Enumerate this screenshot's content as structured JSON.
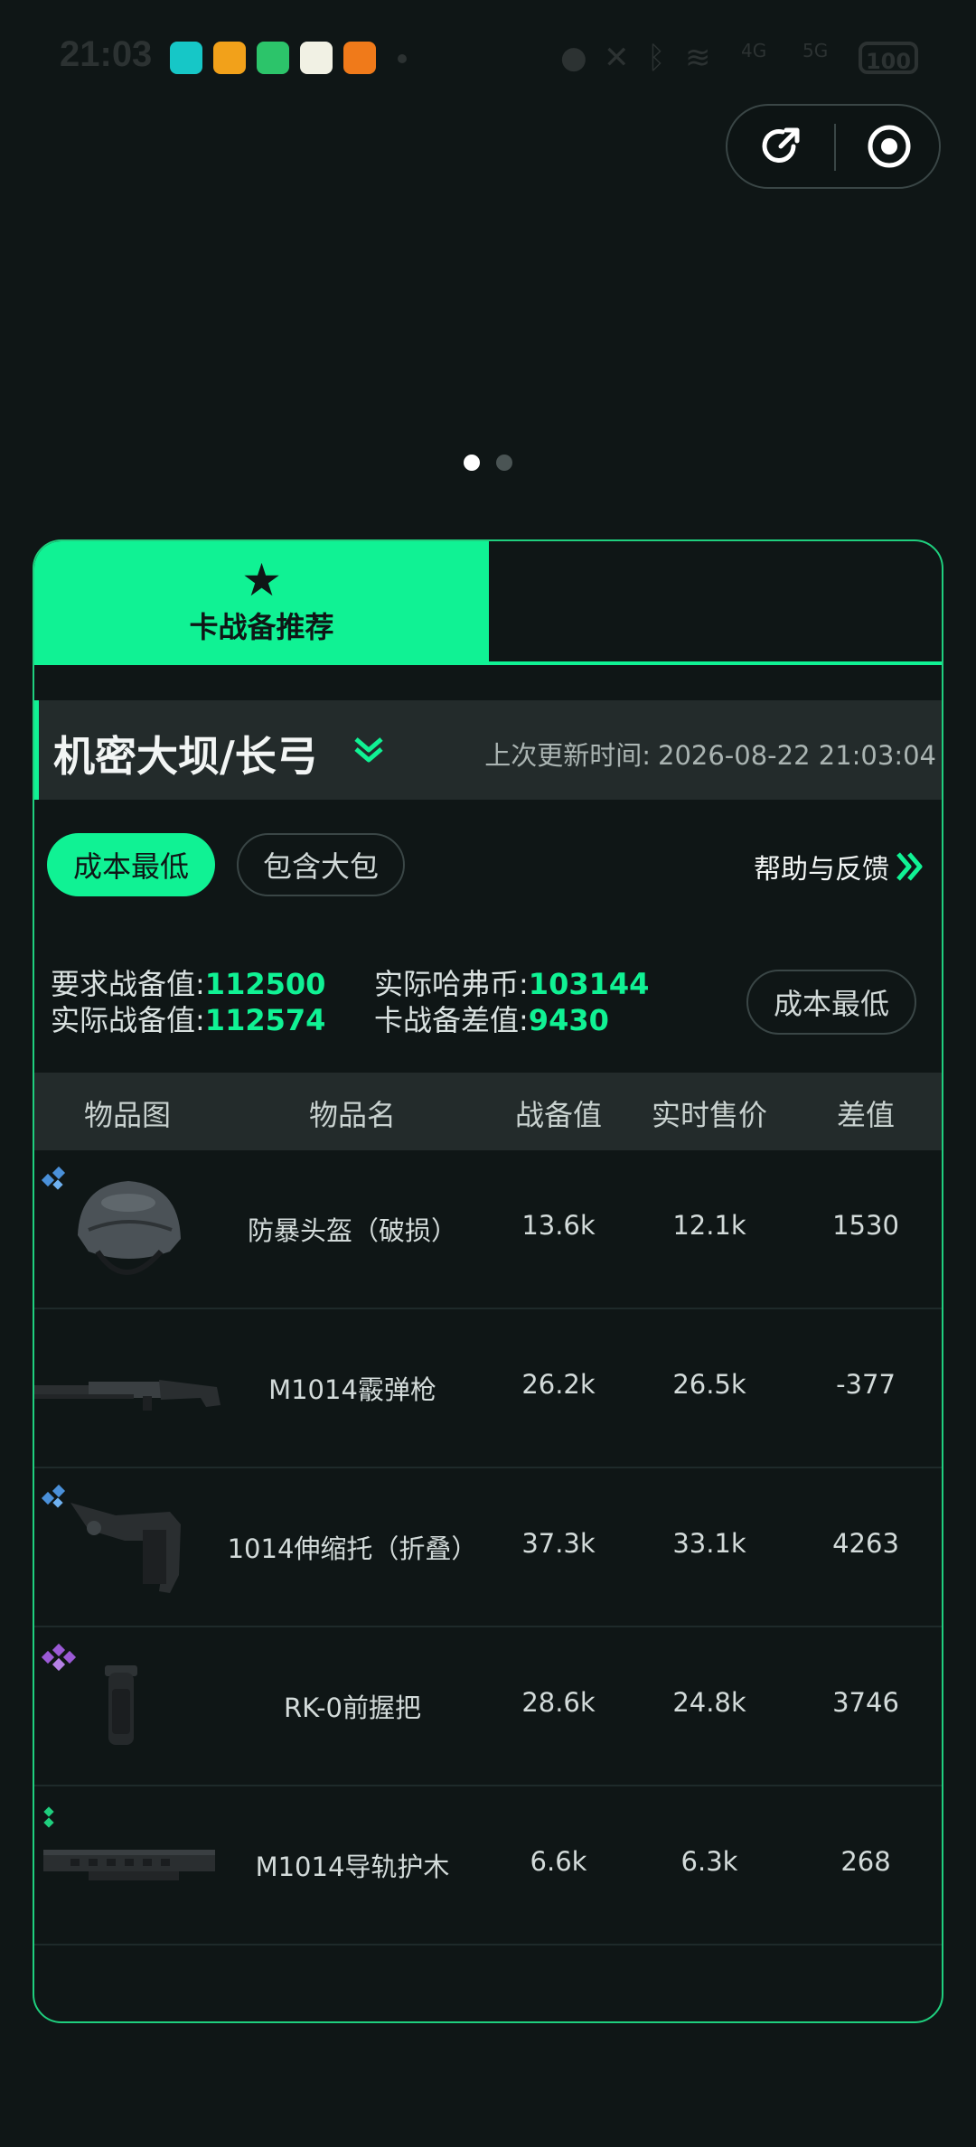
{
  "status_bar": {
    "time": "21:03",
    "app_icons": [
      "tap-icon",
      "app-icon-yellow",
      "battery-saver-icon",
      "video-app-icon",
      "orange-app-icon"
    ],
    "battery": "100",
    "network": [
      "4G",
      "5G"
    ]
  },
  "capsule": {
    "share_icon": "share-icon",
    "close_icon": "record-icon"
  },
  "pager": {
    "count": 2,
    "active_index": 0
  },
  "tabs": [
    {
      "label": "卡战备推荐",
      "icon": "star-icon",
      "active": true
    },
    {
      "label": "",
      "active": false
    }
  ],
  "map": {
    "name": "机密大坝/长弓",
    "update_label": "上次更新时间:",
    "update_time": "2026-08-22 21:03:04"
  },
  "filters": [
    {
      "label": "成本最低",
      "active": true
    },
    {
      "label": "包含大包",
      "active": false
    }
  ],
  "help_label": "帮助与反馈",
  "stats": {
    "required_label": "要求战备值:",
    "required_value": "112500",
    "actual_label": "实际战备值:",
    "actual_value": "112574",
    "coins_label": "实际哈弗币:",
    "coins_value": "103144",
    "diff_label": "卡战备差值:",
    "diff_value": "9430",
    "sort_button": "成本最低"
  },
  "table": {
    "headers": [
      "物品图",
      "物品名",
      "战备值",
      "实时售价",
      "差值"
    ],
    "rows": [
      {
        "image": "helmet-image",
        "rarity": "blue",
        "name": "防暴头盔（破损）",
        "value": "13.6k",
        "price": "12.1k",
        "diff": "1530"
      },
      {
        "image": "shotgun-image",
        "rarity": "none",
        "name": "M1014霰弹枪",
        "value": "26.2k",
        "price": "26.5k",
        "diff": "-377"
      },
      {
        "image": "stock-image",
        "rarity": "blue",
        "name": "1014伸缩托（折叠）",
        "value": "37.3k",
        "price": "33.1k",
        "diff": "4263"
      },
      {
        "image": "grip-image",
        "rarity": "purple",
        "name": "RK-0前握把",
        "value": "28.6k",
        "price": "24.8k",
        "diff": "3746"
      },
      {
        "image": "handguard-image",
        "rarity": "green",
        "name": "M1014导轨护木",
        "value": "6.6k",
        "price": "6.3k",
        "diff": "268"
      }
    ]
  },
  "colors": {
    "accent": "#10f294",
    "background": "#0f1616",
    "panel": "#232b2b",
    "rarity_blue": "#4a90d9",
    "rarity_purple": "#9b5ad6",
    "rarity_green": "#1fcf7e"
  }
}
